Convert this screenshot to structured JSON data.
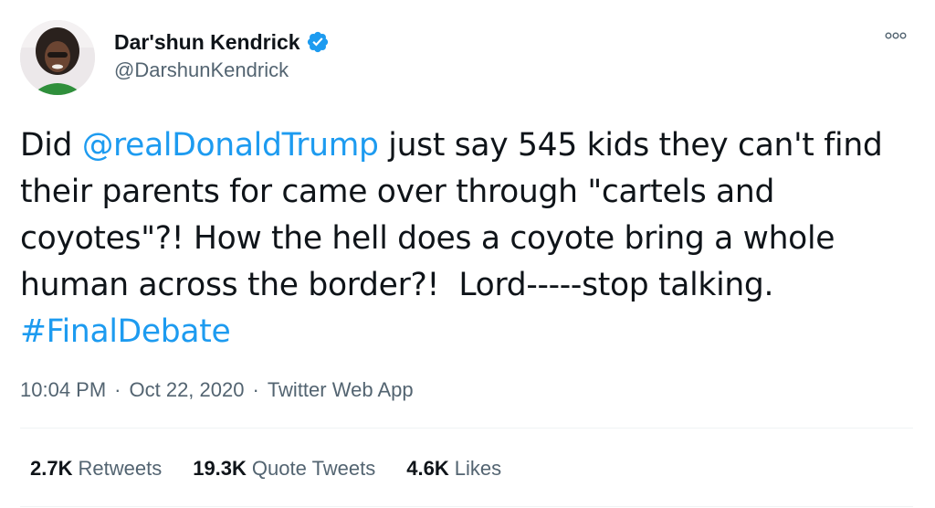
{
  "author": {
    "display_name": "Dar'shun Kendrick",
    "handle": "@DarshunKendrick",
    "verified": true,
    "avatar_icon": "profile-photo"
  },
  "tweet": {
    "text_parts": [
      "Did ",
      "@realDonaldTrump",
      " just say 545 kids they can't find\ntheir parents for came over through \"cartels and\ncoyotes\"?! How the hell does a coyote bring a whole\nhuman across the border?!  Lord-----stop talking.\n",
      "#FinalDebate"
    ],
    "time": "10:04 PM",
    "date": "Oct 22, 2020",
    "separator": "·",
    "source": "Twitter Web App"
  },
  "stats": {
    "retweets": {
      "count": "2.7K",
      "label": "Retweets"
    },
    "quote_tweets": {
      "count": "19.3K",
      "label": "Quote Tweets"
    },
    "likes": {
      "count": "4.6K",
      "label": "Likes"
    }
  },
  "colors": {
    "link": "#1d9bf0",
    "secondary_text": "#536471",
    "primary_text": "#0f1419",
    "verified": "#1d9bf0"
  },
  "icons": {
    "more": "more-icon",
    "verified": "verified-badge-icon"
  }
}
